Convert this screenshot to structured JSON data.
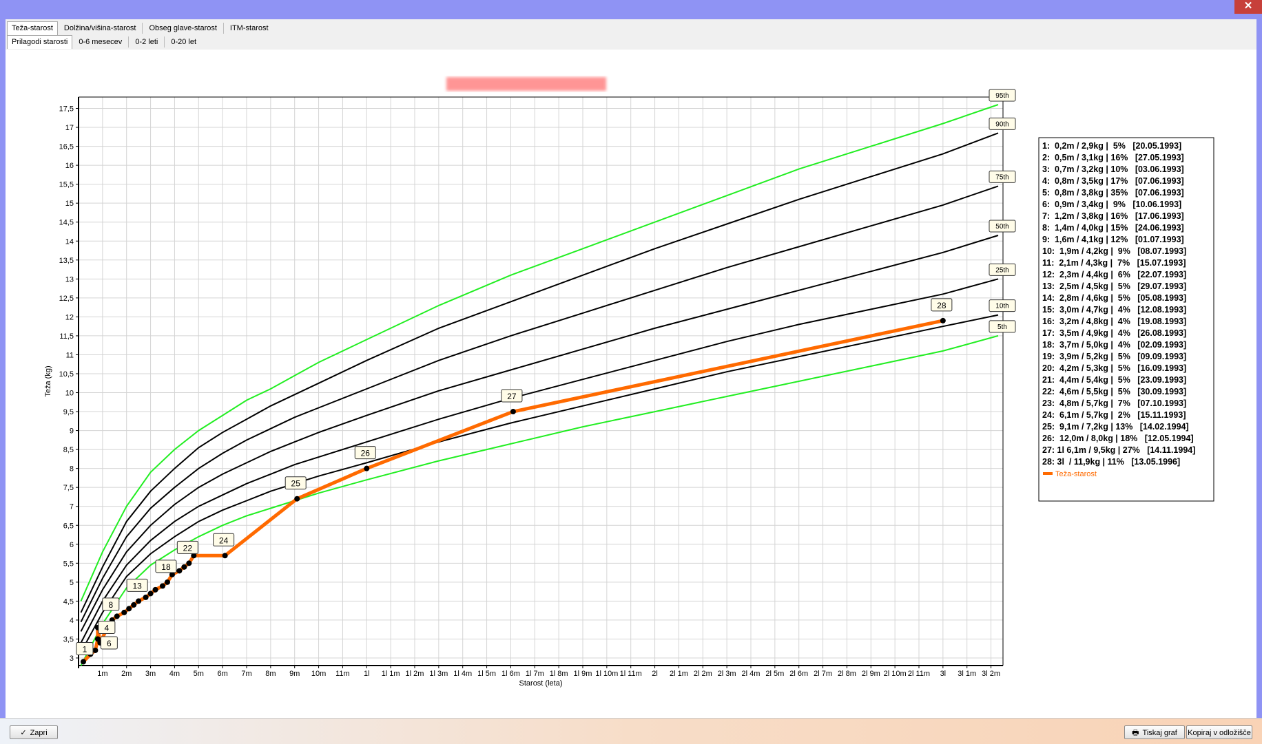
{
  "tabs_row1": [
    "Teža-starost",
    "Dolžina/višina-starost",
    "Obseg glave-starost",
    "ITM-starost"
  ],
  "tabs_row2": [
    "Prilagodi starosti",
    "0-6 mesecev",
    "0-2 leti",
    "0-20 let"
  ],
  "buttons": {
    "close": "Zapri",
    "print": "Tiskaj graf",
    "copy": "Kopiraj v odložišče"
  },
  "window": {
    "close_glyph": "✕"
  },
  "chart_data": {
    "type": "line",
    "title": "",
    "xlabel": "Starost (leta)",
    "ylabel": "Teža (kg)",
    "xlim": [
      0,
      38.5
    ],
    "ylim": [
      2.8,
      17.8
    ],
    "grid": true,
    "legend_position": "right",
    "y_ticks": [
      3,
      3.5,
      4,
      4.5,
      5,
      5.5,
      6,
      6.5,
      7,
      7.5,
      8,
      8.5,
      9,
      9.5,
      10,
      10.5,
      11,
      11.5,
      12,
      12.5,
      13,
      13.5,
      14,
      14.5,
      15,
      15.5,
      16,
      16.5,
      17,
      17.5
    ],
    "y_tick_labels": [
      "3",
      "3,5",
      "4",
      "4,5",
      "5",
      "5,5",
      "6",
      "6,5",
      "7",
      "7,5",
      "8",
      "8,5",
      "9",
      "9,5",
      "10",
      "10,5",
      "11",
      "11,5",
      "12",
      "12,5",
      "13",
      "13,5",
      "14",
      "14,5",
      "15",
      "15,5",
      "16",
      "16,5",
      "17",
      "17,5"
    ],
    "x_tick_labels": [
      "1m",
      "2m",
      "3m",
      "4m",
      "5m",
      "6m",
      "7m",
      "8m",
      "9m",
      "10m",
      "11m",
      "1l",
      "1l 1m",
      "1l 2m",
      "1l 3m",
      "1l 4m",
      "1l 5m",
      "1l 6m",
      "1l 7m",
      "1l 8m",
      "1l 9m",
      "1l 10m",
      "1l 11m",
      "2l",
      "2l 1m",
      "2l 2m",
      "2l 3m",
      "2l 4m",
      "2l 5m",
      "2l 6m",
      "2l 7m",
      "2l 8m",
      "2l 9m",
      "2l 10m",
      "2l 11m",
      "3l",
      "3l 1m",
      "3l 2m"
    ],
    "percentile_x": [
      0.1,
      1,
      2,
      3,
      4,
      5,
      6,
      7,
      8,
      9,
      10,
      12,
      15,
      18,
      21,
      24,
      27,
      30,
      33,
      36,
      38.3
    ],
    "percentiles": [
      {
        "name": "95th",
        "color": "#22ee22",
        "values": [
          4.5,
          5.8,
          7.0,
          7.9,
          8.5,
          9.0,
          9.4,
          9.8,
          10.1,
          10.45,
          10.8,
          11.4,
          12.3,
          13.1,
          13.8,
          14.5,
          15.2,
          15.9,
          16.5,
          17.1,
          17.6
        ]
      },
      {
        "name": "90th",
        "color": "#000000",
        "values": [
          4.2,
          5.4,
          6.6,
          7.4,
          8.0,
          8.55,
          8.95,
          9.3,
          9.65,
          9.95,
          10.25,
          10.85,
          11.7,
          12.4,
          13.1,
          13.8,
          14.45,
          15.1,
          15.7,
          16.3,
          16.85
        ]
      },
      {
        "name": "75th",
        "color": "#000000",
        "values": [
          3.95,
          5.1,
          6.2,
          6.95,
          7.5,
          8.0,
          8.4,
          8.75,
          9.05,
          9.35,
          9.6,
          10.1,
          10.85,
          11.5,
          12.1,
          12.7,
          13.3,
          13.85,
          14.4,
          14.95,
          15.45
        ]
      },
      {
        "name": "50th",
        "color": "#000000",
        "values": [
          3.7,
          4.8,
          5.8,
          6.5,
          7.05,
          7.5,
          7.85,
          8.15,
          8.45,
          8.7,
          8.95,
          9.4,
          10.05,
          10.6,
          11.15,
          11.7,
          12.2,
          12.7,
          13.2,
          13.7,
          14.15
        ]
      },
      {
        "name": "25th",
        "color": "#000000",
        "values": [
          3.4,
          4.5,
          5.45,
          6.1,
          6.6,
          7.0,
          7.3,
          7.6,
          7.85,
          8.1,
          8.3,
          8.7,
          9.3,
          9.85,
          10.35,
          10.85,
          11.35,
          11.8,
          12.2,
          12.6,
          13.0
        ]
      },
      {
        "name": "10th",
        "color": "#000000",
        "values": [
          3.15,
          4.2,
          5.15,
          5.75,
          6.2,
          6.6,
          6.9,
          7.15,
          7.4,
          7.6,
          7.8,
          8.15,
          8.7,
          9.2,
          9.65,
          10.1,
          10.55,
          10.95,
          11.35,
          11.75,
          12.05
        ]
      },
      {
        "name": "5th",
        "color": "#22ee22",
        "values": [
          2.8,
          3.9,
          4.85,
          5.45,
          5.85,
          6.2,
          6.5,
          6.75,
          6.95,
          7.15,
          7.35,
          7.7,
          8.2,
          8.65,
          9.1,
          9.5,
          9.9,
          10.3,
          10.7,
          11.1,
          11.5
        ]
      }
    ],
    "series": [
      {
        "name": "Teža-starost",
        "color": "#ff6a00",
        "x": [
          0.2,
          0.5,
          0.7,
          0.8,
          0.8,
          0.9,
          1.2,
          1.4,
          1.6,
          1.9,
          2.1,
          2.3,
          2.5,
          2.8,
          3.0,
          3.2,
          3.5,
          3.7,
          3.9,
          4.2,
          4.4,
          4.6,
          4.8,
          6.1,
          9.1,
          12.0,
          18.1,
          36.0
        ],
        "values": [
          2.9,
          3.1,
          3.2,
          3.5,
          3.8,
          3.4,
          3.8,
          4.0,
          4.1,
          4.2,
          4.3,
          4.4,
          4.5,
          4.6,
          4.7,
          4.8,
          4.9,
          5.0,
          5.2,
          5.3,
          5.4,
          5.5,
          5.7,
          5.7,
          7.2,
          8.0,
          9.5,
          11.9
        ]
      }
    ],
    "point_labels": [
      "1",
      "2",
      "3",
      "4",
      "5",
      "6",
      "7",
      "8",
      "9",
      "10",
      "11",
      "12",
      "13",
      "14",
      "15",
      "16",
      "17",
      "18",
      "19",
      "20",
      "21",
      "22",
      "23",
      "24",
      "25",
      "26",
      "27",
      "28"
    ],
    "labeled_points": [
      1,
      4,
      6,
      8,
      13,
      18,
      22,
      24,
      25,
      26,
      27,
      28
    ],
    "legend_entries": [
      "1:  0,2m / 2,9kg |  5%   [20.05.1993]",
      "2:  0,5m / 3,1kg | 16%   [27.05.1993]",
      "3:  0,7m / 3,2kg | 10%   [03.06.1993]",
      "4:  0,8m / 3,5kg | 17%   [07.06.1993]",
      "5:  0,8m / 3,8kg | 35%   [07.06.1993]",
      "6:  0,9m / 3,4kg |  9%   [10.06.1993]",
      "7:  1,2m / 3,8kg | 16%   [17.06.1993]",
      "8:  1,4m / 4,0kg | 15%   [24.06.1993]",
      "9:  1,6m / 4,1kg | 12%   [01.07.1993]",
      "10:  1,9m / 4,2kg |  9%   [08.07.1993]",
      "11:  2,1m / 4,3kg |  7%   [15.07.1993]",
      "12:  2,3m / 4,4kg |  6%   [22.07.1993]",
      "13:  2,5m / 4,5kg |  5%   [29.07.1993]",
      "14:  2,8m / 4,6kg |  5%   [05.08.1993]",
      "15:  3,0m / 4,7kg |  4%   [12.08.1993]",
      "16:  3,2m / 4,8kg |  4%   [19.08.1993]",
      "17:  3,5m / 4,9kg |  4%   [26.08.1993]",
      "18:  3,7m / 5,0kg |  4%   [02.09.1993]",
      "19:  3,9m / 5,2kg |  5%   [09.09.1993]",
      "20:  4,2m / 5,3kg |  5%   [16.09.1993]",
      "21:  4,4m / 5,4kg |  5%   [23.09.1993]",
      "22:  4,6m / 5,5kg |  5%   [30.09.1993]",
      "23:  4,8m / 5,7kg |  7%   [07.10.1993]",
      "24:  6,1m / 5,7kg |  2%   [15.11.1993]",
      "25:  9,1m / 7,2kg | 13%   [14.02.1994]",
      "26:  12,0m / 8,0kg | 18%   [12.05.1994]",
      "27: 1l 6,1m / 9,5kg | 27%   [14.11.1994]",
      "28: 3l  / 11,9kg | 11%   [13.05.1996]"
    ],
    "legend_series_label": "Teža-starost"
  }
}
